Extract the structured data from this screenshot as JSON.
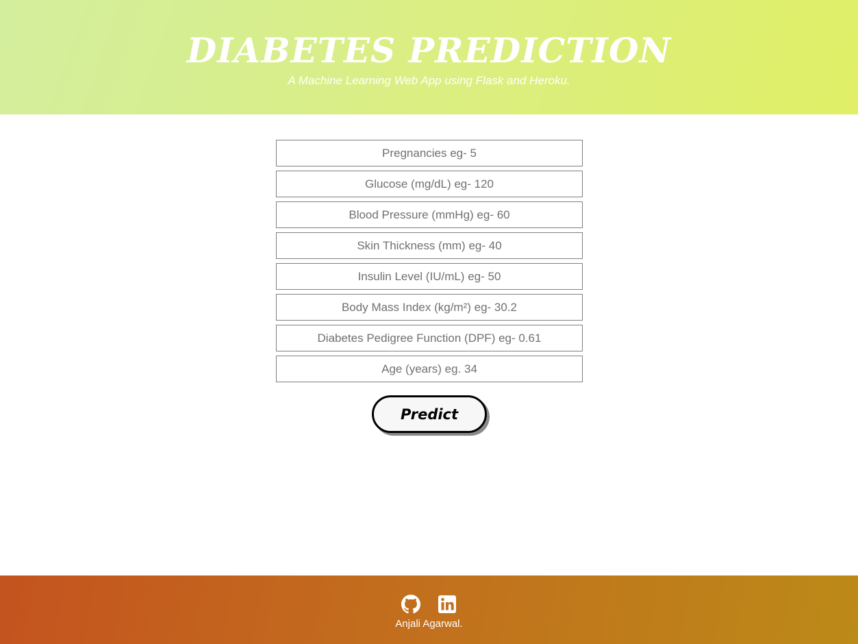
{
  "header": {
    "title": "DIABETES PREDICTION",
    "subtitle": "A Machine Learning Web App using Flask and Heroku."
  },
  "form": {
    "fields": [
      {
        "placeholder": "Pregnancies eg- 5",
        "value": ""
      },
      {
        "placeholder": "Glucose (mg/dL) eg- 120",
        "value": ""
      },
      {
        "placeholder": "Blood Pressure (mmHg) eg- 60",
        "value": ""
      },
      {
        "placeholder": "Skin Thickness (mm) eg- 40",
        "value": ""
      },
      {
        "placeholder": "Insulin Level (IU/mL) eg- 50",
        "value": ""
      },
      {
        "placeholder": "Body Mass Index (kg/m²) eg- 30.2",
        "value": ""
      },
      {
        "placeholder": "Diabetes Pedigree Function (DPF) eg- 0.61",
        "value": ""
      },
      {
        "placeholder": "Age (years) eg. 34",
        "value": ""
      }
    ],
    "submit_label": "Predict"
  },
  "footer": {
    "icons": [
      "github-icon",
      "linkedin-icon"
    ],
    "author": "Anjali Agarwal."
  },
  "colors": {
    "header_gradient": [
      "#d3ee9e",
      "#e0ef66"
    ],
    "footer_gradient": [
      "#c4531f",
      "#bc8a18"
    ],
    "text_on_banner": "#ffffff"
  }
}
